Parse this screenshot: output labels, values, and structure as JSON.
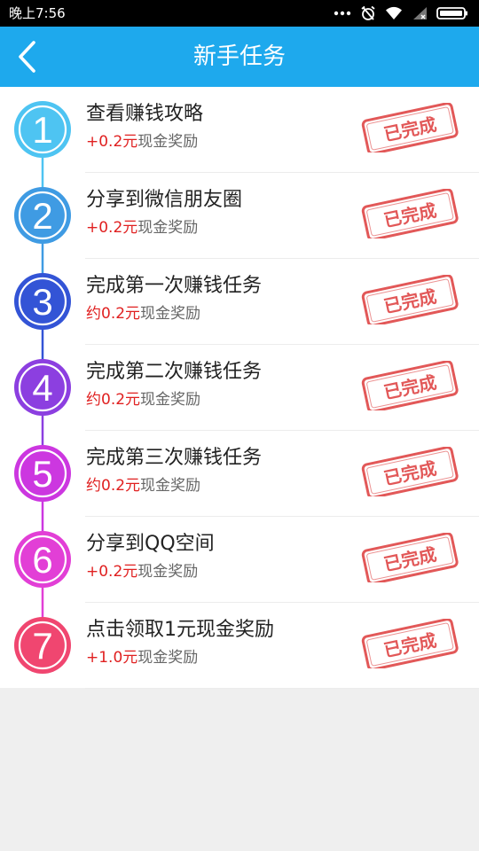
{
  "status_bar": {
    "time": "晚上7:56"
  },
  "header": {
    "title": "新手任务"
  },
  "tasks": [
    {
      "number": "1",
      "title": "查看赚钱攻略",
      "amount": "+0.2元",
      "reward_suffix": "现金奖励",
      "status": "已完成",
      "color": "#4ec4f2"
    },
    {
      "number": "2",
      "title": "分享到微信朋友圈",
      "amount": "+0.2元",
      "reward_suffix": "现金奖励",
      "status": "已完成",
      "color": "#3f9be3"
    },
    {
      "number": "3",
      "title": "完成第一次赚钱任务",
      "amount": "约0.2元",
      "reward_suffix": "现金奖励",
      "status": "已完成",
      "color": "#3354d6"
    },
    {
      "number": "4",
      "title": "完成第二次赚钱任务",
      "amount": "约0.2元",
      "reward_suffix": "现金奖励",
      "status": "已完成",
      "color": "#8c3fe0"
    },
    {
      "number": "5",
      "title": "完成第三次赚钱任务",
      "amount": "约0.2元",
      "reward_suffix": "现金奖励",
      "status": "已完成",
      "color": "#cc37e0"
    },
    {
      "number": "6",
      "title": "分享到QQ空间",
      "amount": "+0.2元",
      "reward_suffix": "现金奖励",
      "status": "已完成",
      "color": "#e23fd6"
    },
    {
      "number": "7",
      "title": "点击领取1元现金奖励",
      "amount": "+1.0元",
      "reward_suffix": "现金奖励",
      "status": "已完成",
      "color": "#f04670"
    }
  ],
  "colors": {
    "header_bg": "#1ea9ed",
    "reward_red": "#e02020",
    "stamp_red": "#dd3b3b"
  },
  "icons": [
    "back-arrow-icon",
    "more-dots-icon",
    "alarm-off-icon",
    "wifi-icon",
    "cellular-signal-icon",
    "battery-icon"
  ]
}
